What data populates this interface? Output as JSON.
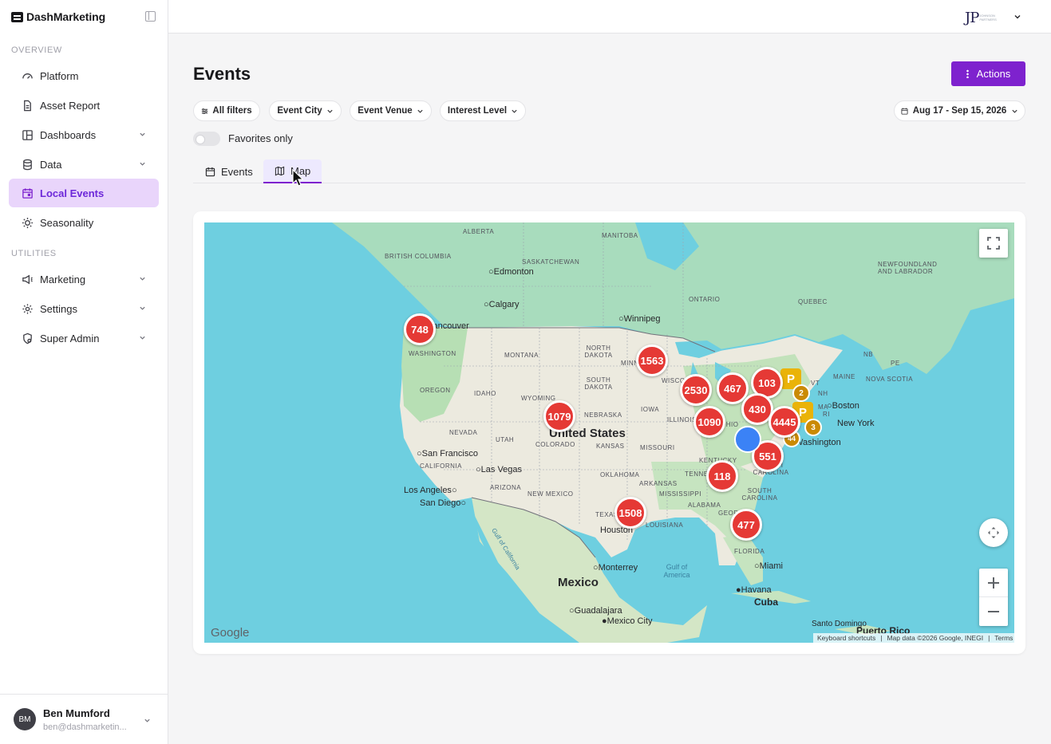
{
  "sidebar": {
    "brand": "DashMarketing",
    "sections": [
      {
        "label": "OVERVIEW"
      },
      {
        "label": "UTILITIES"
      }
    ],
    "items": [
      {
        "label": "Platform",
        "icon": "gauge-icon"
      },
      {
        "label": "Asset Report",
        "icon": "file-icon"
      },
      {
        "label": "Dashboards",
        "icon": "dashboard-icon"
      },
      {
        "label": "Data",
        "icon": "database-icon"
      },
      {
        "label": "Local Events",
        "icon": "calendar-icon",
        "active": true
      },
      {
        "label": "Seasonality",
        "icon": "sun-icon"
      },
      {
        "label": "Marketing",
        "icon": "megaphone-icon"
      },
      {
        "label": "Settings",
        "icon": "gear-icon"
      },
      {
        "label": "Super Admin",
        "icon": "shield-icon"
      }
    ],
    "user": {
      "initials": "BM",
      "name": "Ben Mumford",
      "email": "ben@dashmarketin..."
    }
  },
  "topbar": {
    "logo_text": "JP",
    "logo_sub": "JOHNSON PARTNERS"
  },
  "page": {
    "title": "Events",
    "actions_label": "Actions",
    "filters": [
      "All filters",
      "Event City",
      "Event Venue",
      "Interest Level"
    ],
    "date_range": "Aug 17 - Sep 15, 2026",
    "favorites_label": "Favorites only",
    "tabs": [
      {
        "label": "Events"
      },
      {
        "label": "Map",
        "active": true
      }
    ]
  },
  "map": {
    "clusters": [
      "748",
      "1563",
      "2530",
      "467",
      "103",
      "430",
      "1090",
      "4445",
      "1079",
      "551",
      "118",
      "1508",
      "477"
    ],
    "small_markers": [
      "2",
      "3",
      "44"
    ],
    "regions": [
      "ALBERTA",
      "MANITOBA",
      "BRITISH COLUMBIA",
      "SASKATCHEWAN",
      "NEWFOUNDLAND AND LABRADOR",
      "ONTARIO",
      "QUEBEC",
      "WASHINGTON",
      "MONTANA",
      "NORTH DAKOTA",
      "SOUTH DAKOTA",
      "OREGON",
      "IDAHO",
      "WYOMING",
      "NEBRASKA",
      "IOWA",
      "ILLINOIS",
      "NEVADA",
      "UTAH",
      "COLORADO",
      "KANSAS",
      "MISSOURI",
      "CALIFORNIA",
      "ARIZONA",
      "NEW MEXICO",
      "OKLAHOMA",
      "ARKANSAS",
      "MISSISSIPPI",
      "ALABAMA",
      "TEXAS",
      "LOUISIANA",
      "FLORIDA",
      "NB",
      "PE",
      "NOVA SCOTIA",
      "MAINE",
      "VT",
      "NH",
      "MA",
      "RI",
      "KENTUCKY",
      "TENNESSEE",
      "NORTH CAROLINA",
      "SOUTH CAROLINA",
      "GEORGIA",
      "OHIO",
      "WISCONSIN",
      "MINNESOTA"
    ],
    "cities": [
      "Edmonton",
      "Calgary",
      "Winnipeg",
      "Vancouver",
      "San Francisco",
      "Las Vegas",
      "Los Angeles",
      "San Diego",
      "Houston",
      "Monterrey",
      "Miami",
      "Havana",
      "Guadalajara",
      "Mexico City",
      "Boston",
      "New York",
      "Washington"
    ],
    "countries": [
      "United States",
      "Mexico",
      "Cuba",
      "Puerto Rico",
      "Santo Domingo"
    ],
    "water": [
      "Gulf of America",
      "Gulf of California"
    ],
    "attribution": {
      "shortcuts": "Keyboard shortcuts",
      "data": "Map data ©2026 Google, INEGI",
      "terms": "Terms"
    },
    "google": "Google"
  }
}
